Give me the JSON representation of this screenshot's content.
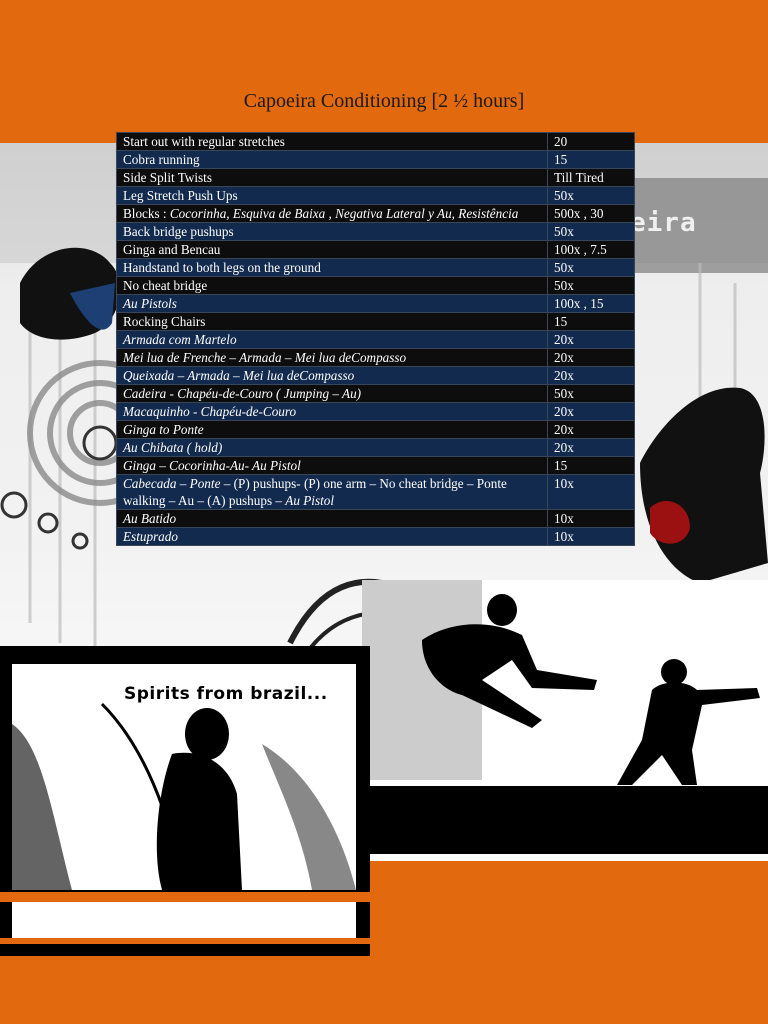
{
  "title": "Capoeira Conditioning [2 ½ hours]",
  "brand_fragment": "eira",
  "poster_caption": "Spirits from brazil...",
  "rows": [
    {
      "style": "dark",
      "parts": [
        {
          "t": "Start out with regular stretches",
          "i": false
        }
      ],
      "value": "20"
    },
    {
      "style": "blue",
      "parts": [
        {
          "t": "Cobra running",
          "i": false
        }
      ],
      "value": "15"
    },
    {
      "style": "dark",
      "parts": [
        {
          "t": "Side Split Twists",
          "i": false
        }
      ],
      "value": "Till Tired"
    },
    {
      "style": "blue",
      "parts": [
        {
          "t": "Leg Stretch Push Ups",
          "i": false
        }
      ],
      "value": "50x"
    },
    {
      "style": "dark",
      "parts": [
        {
          "t": "Blocks : ",
          "i": false
        },
        {
          "t": "Cocorinha, Esquiva de Baixa , Negativa Lateral y Au, Resistência",
          "i": true
        }
      ],
      "value": "500x , 30"
    },
    {
      "style": "blue",
      "parts": [
        {
          "t": "Back bridge pushups",
          "i": false
        }
      ],
      "value": "50x"
    },
    {
      "style": "dark",
      "parts": [
        {
          "t": "Ginga and Bencau",
          "i": false
        }
      ],
      "value": "100x , 7.5"
    },
    {
      "style": "blue",
      "parts": [
        {
          "t": "Handstand to both legs on the ground",
          "i": false
        }
      ],
      "value": "50x"
    },
    {
      "style": "dark",
      "parts": [
        {
          "t": "No cheat bridge",
          "i": false
        }
      ],
      "value": "50x"
    },
    {
      "style": "blue",
      "parts": [
        {
          "t": "Au Pistols",
          "i": true
        }
      ],
      "value": "100x , 15"
    },
    {
      "style": "dark",
      "parts": [
        {
          "t": "Rocking Chairs",
          "i": false
        }
      ],
      "value": "15"
    },
    {
      "style": "blue",
      "parts": [
        {
          "t": "Armada com Martelo",
          "i": true
        }
      ],
      "value": "20x"
    },
    {
      "style": "dark",
      "parts": [
        {
          "t": "Mei lua de Frenche – Armada – Mei lua deCompasso",
          "i": true
        }
      ],
      "value": "20x"
    },
    {
      "style": "blue",
      "parts": [
        {
          "t": "Queixada – Armada – Mei lua deCompasso",
          "i": true
        }
      ],
      "value": "20x"
    },
    {
      "style": "dark",
      "parts": [
        {
          "t": "Cadeira - Chapéu-de-Couro ( Jumping – Au)",
          "i": true
        }
      ],
      "value": "50x"
    },
    {
      "style": "blue",
      "parts": [
        {
          "t": "Macaquinho - Chapéu-de-Couro",
          "i": true
        }
      ],
      "value": "20x"
    },
    {
      "style": "dark",
      "parts": [
        {
          "t": "Ginga to Ponte",
          "i": true
        }
      ],
      "value": "20x"
    },
    {
      "style": "blue",
      "parts": [
        {
          "t": "Au Chibata  ( hold)",
          "i": true
        }
      ],
      "value": "20x"
    },
    {
      "style": "dark",
      "parts": [
        {
          "t": "Ginga – Cocorinha-Au- Au Pistol",
          "i": true
        }
      ],
      "value": "15"
    },
    {
      "style": "blue",
      "parts": [
        {
          "t": "Cabecada – Ponte",
          "i": true
        },
        {
          "t": " – (P) pushups- (P) one arm – No cheat bridge – Ponte walking – Au – (A) pushups – ",
          "i": false
        },
        {
          "t": "Au Pistol",
          "i": true
        }
      ],
      "value": "10x"
    },
    {
      "style": "dark",
      "parts": [
        {
          "t": "Au Batido",
          "i": true
        }
      ],
      "value": "10x"
    },
    {
      "style": "blue",
      "parts": [
        {
          "t": "Estuprado",
          "i": true
        }
      ],
      "value": "10x"
    }
  ]
}
